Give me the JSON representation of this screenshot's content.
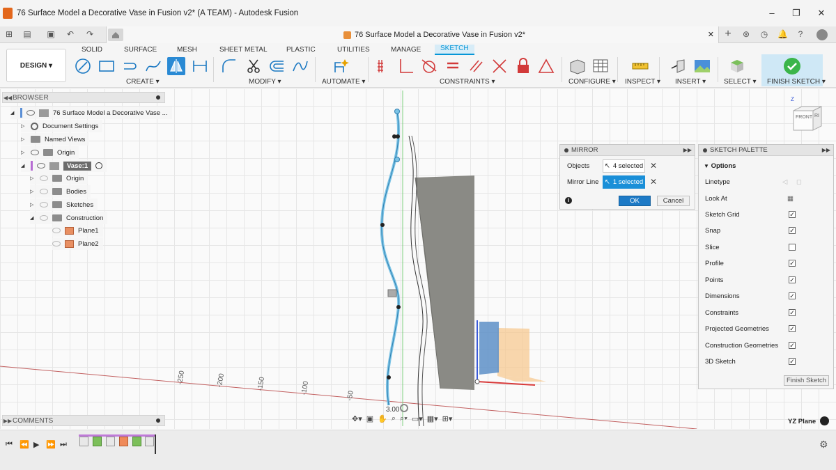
{
  "window": {
    "title": "76 Surface Model a Decorative Vase in Fusion v2* (A TEAM) - Autodesk Fusion",
    "minimize": "–",
    "maximize": "❐",
    "close": "✕"
  },
  "doc_tab": {
    "title": "76 Surface Model a Decorative Vase in Fusion v2*",
    "close": "✕"
  },
  "ribbon": {
    "workspace": "DESIGN ▾",
    "tabs": [
      "SOLID",
      "SURFACE",
      "MESH",
      "SHEET METAL",
      "PLASTIC",
      "UTILITIES",
      "MANAGE",
      "SKETCH"
    ],
    "groups": [
      "CREATE ▾",
      "MODIFY ▾",
      "AUTOMATE ▾",
      "CONSTRAINTS ▾",
      "CONFIGURE ▾",
      "INSPECT ▾",
      "INSERT ▾",
      "SELECT ▾",
      "FINISH SKETCH ▾"
    ]
  },
  "browser": {
    "header": "BROWSER",
    "items": [
      "76 Surface Model a Decorative Vase ...",
      "Document Settings",
      "Named Views",
      "Origin",
      "Vase:1",
      "Origin",
      "Bodies",
      "Sketches",
      "Construction",
      "Plane1",
      "Plane2"
    ]
  },
  "comments": {
    "header": "COMMENTS"
  },
  "mirror": {
    "title": "MIRROR",
    "objects_label": "Objects",
    "objects_value": "4 selected",
    "line_label": "Mirror Line",
    "line_value": "1 selected",
    "ok": "OK",
    "cancel": "Cancel"
  },
  "palette": {
    "title": "SKETCH PALETTE",
    "section": "Options",
    "rows": [
      {
        "label": "Linetype"
      },
      {
        "label": "Look At"
      },
      {
        "label": "Sketch Grid",
        "checked": true
      },
      {
        "label": "Snap",
        "checked": true
      },
      {
        "label": "Slice",
        "checked": false
      },
      {
        "label": "Profile",
        "checked": true
      },
      {
        "label": "Points",
        "checked": true
      },
      {
        "label": "Dimensions",
        "checked": true
      },
      {
        "label": "Constraints",
        "checked": true
      },
      {
        "label": "Projected Geometries",
        "checked": true
      },
      {
        "label": "Construction Geometries",
        "checked": true
      },
      {
        "label": "3D Sketch",
        "checked": true
      }
    ],
    "finish": "Finish Sketch"
  },
  "viewcube": {
    "front": "FRONT",
    "right": "RI",
    "axis": "Z"
  },
  "canvas": {
    "ruler": [
      "-250",
      "-200",
      "-150",
      "-100",
      "-50"
    ],
    "dimension": "3.00"
  },
  "status": {
    "plane": "YZ Plane"
  }
}
